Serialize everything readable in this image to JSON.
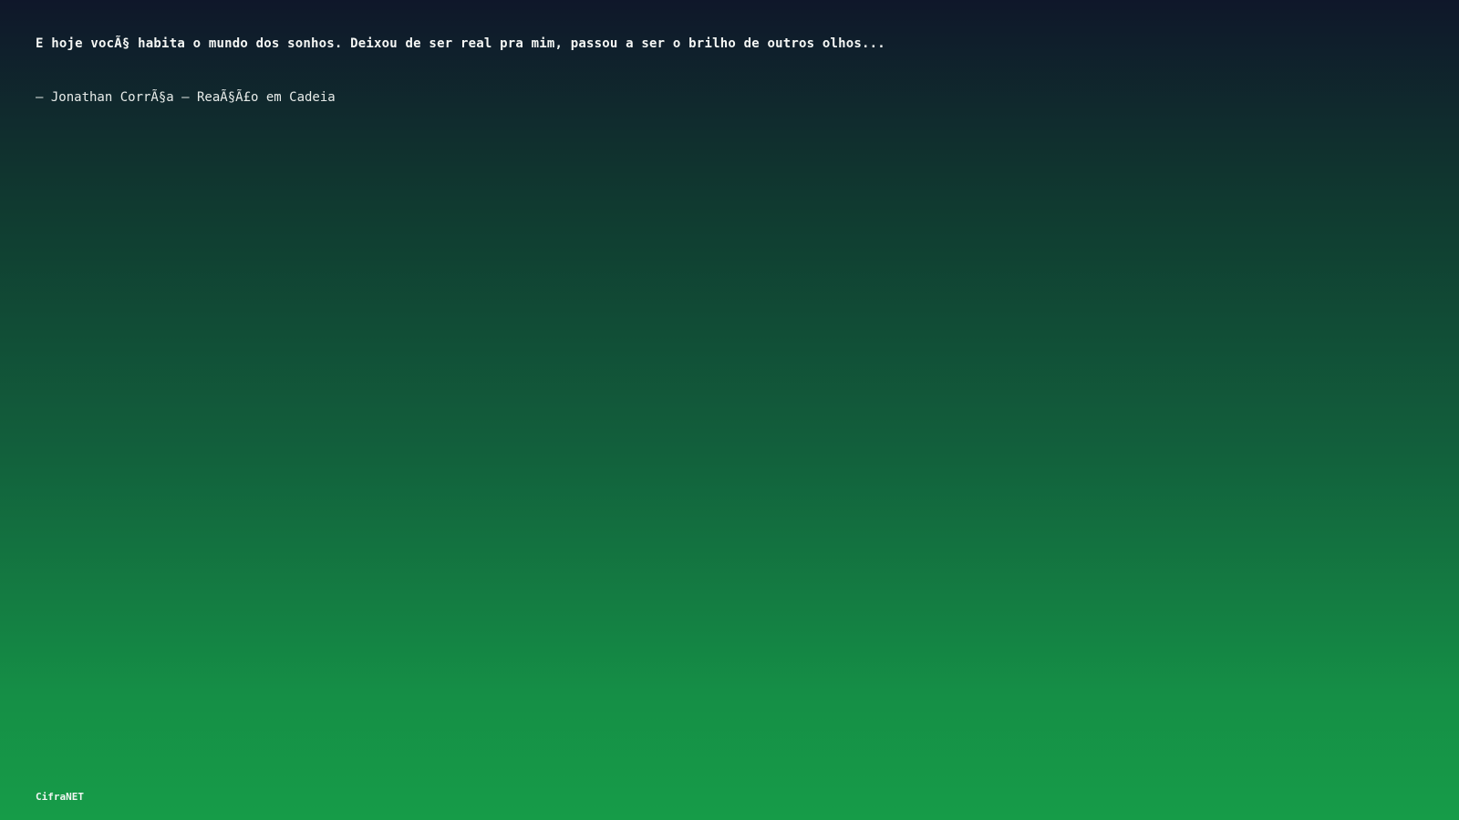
{
  "quote": {
    "text": "E hoje vocÃ§ habita o mundo dos sonhos. Deixou de ser real pra mim, passou a ser o brilho de outros olhos...",
    "attribution": "– Jonathan CorrÃ§a – ReaÃ§Ã£o em Cadeia"
  },
  "brand": {
    "label": "CifraNET"
  },
  "colors": {
    "gradient_top": "#0f172a",
    "gradient_bottom": "#169c48",
    "text": "#ffffff"
  }
}
